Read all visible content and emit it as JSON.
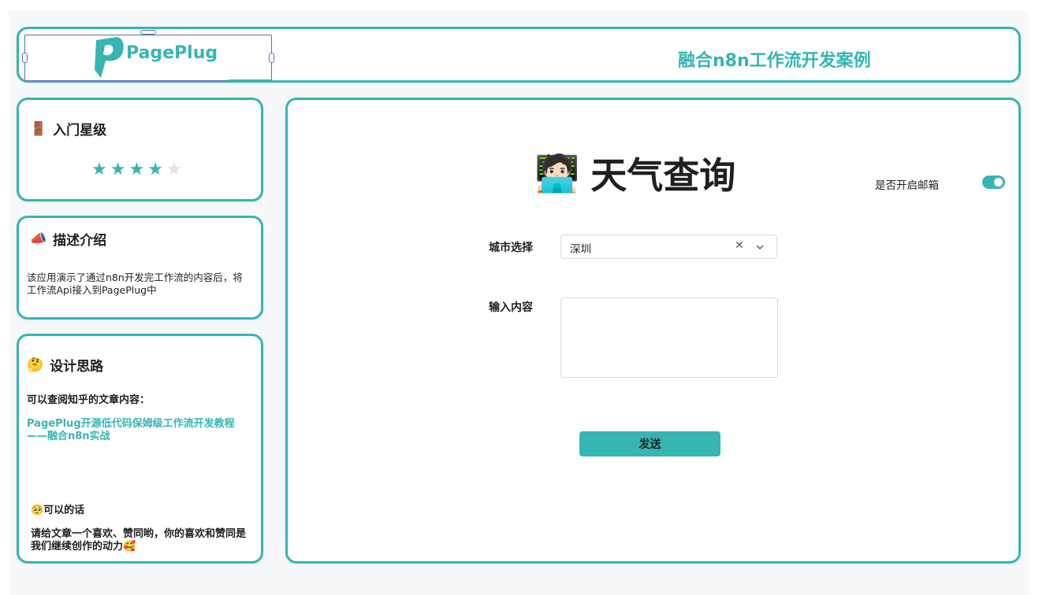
{
  "header": {
    "logo_text": "PagePlug",
    "title": "融合n8n工作流开发案例"
  },
  "stars_card": {
    "emoji": "🚪",
    "title": "入门星级",
    "rating": 4,
    "max": 5
  },
  "desc_card": {
    "emoji": "📣",
    "title": "描述介绍",
    "text": "该应用演示了通过n8n开发完工作流的内容后，将工作流Api接入到PagePlug中"
  },
  "design_card": {
    "emoji": "🤔",
    "title": "设计思路",
    "intro": "可以查阅知乎的文章内容：",
    "link": "PagePlug开源低代码保姆级工作流开发教程——融合n8n实战",
    "ask": "🥺可以的话",
    "thanks": "请给文章一个喜欢、赞同哟，你的喜欢和赞同是我们继续创作的动力🥰"
  },
  "main": {
    "emoji": "🧑🏻‍💻",
    "title": "天气查询",
    "toggle_label": "是否开启邮箱",
    "toggle_on": true,
    "city_label": "城市选择",
    "city_value": "深圳",
    "content_label": "输入内容",
    "content_value": "",
    "send_label": "发送"
  },
  "colors": {
    "accent": "#36b5b3",
    "star_off": "#e2e2e2"
  }
}
